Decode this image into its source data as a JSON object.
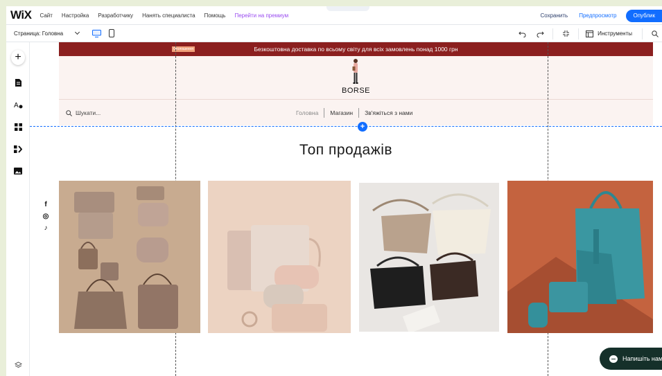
{
  "app": {
    "logo": "WiX",
    "menu": [
      "Сайт",
      "Настройка",
      "Разработчику",
      "Нанять специалиста",
      "Помощь",
      "Перейти на премиум"
    ],
    "save_label": "Сохранить",
    "preview_label": "Предпросмотр",
    "publish_label": "Опублик"
  },
  "toolbar": {
    "page_label": "Страница: Головна",
    "tools_label": "Инструменты"
  },
  "site": {
    "announcement": "Безкоштовна доставка по всьому світу для всіх замовлень понад 1000 грн",
    "announcement_tag": "Оголошення",
    "brand": "BORSE",
    "search_placeholder": "Шукати...",
    "nav": [
      "Головна",
      "Магазин",
      "Зв'яжіться з нами"
    ],
    "section_title": "Топ продажів",
    "social": [
      "f",
      "◎",
      "♪"
    ]
  },
  "chat": {
    "label": "Напишіть нам"
  },
  "colors": {
    "accent": "#116dff",
    "announcement_bg": "#8b1f1f",
    "header_bg": "#fbf3f1",
    "chat_bg": "#15302a"
  }
}
